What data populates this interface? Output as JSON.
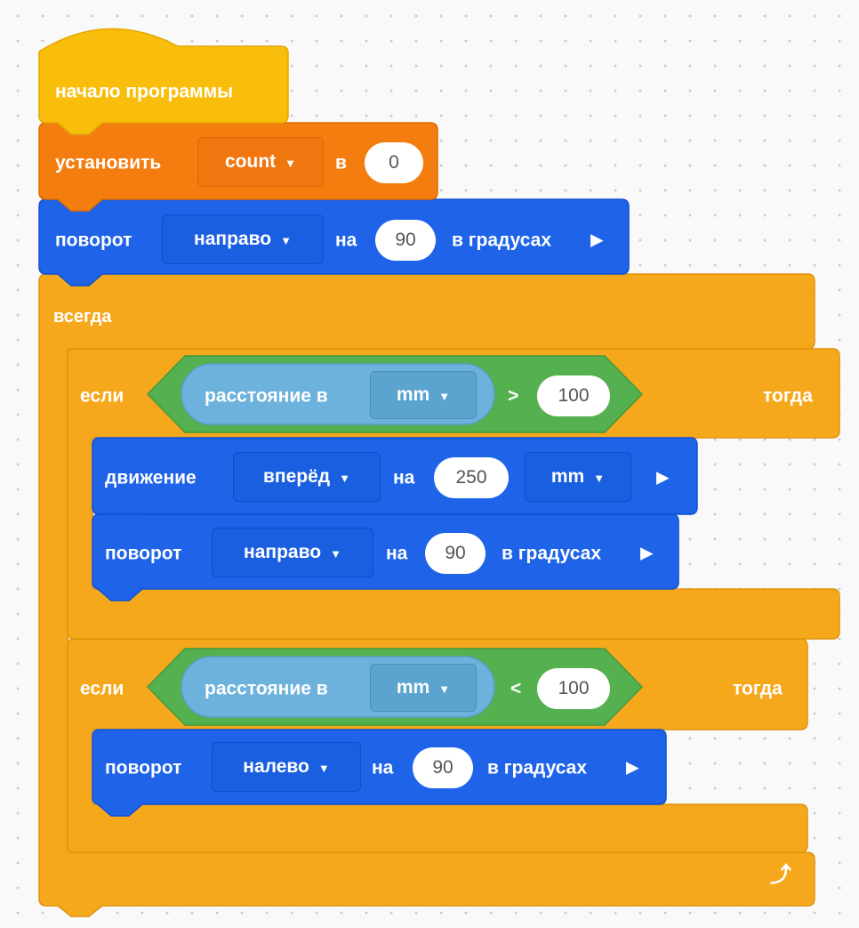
{
  "program": {
    "hat": {
      "label": "начало программы"
    },
    "set_var": {
      "label": "установить",
      "variable": "count",
      "to_label": "в",
      "value": "0"
    },
    "turn1": {
      "label": "поворот",
      "direction": "направо",
      "by_label": "на",
      "value": "90",
      "unit": "в градусах"
    },
    "forever": {
      "label": "всегда",
      "loop_icon": "loop-arrow-icon"
    },
    "if1": {
      "label": "если",
      "sensor": {
        "label": "расстояние в",
        "unit": "mm"
      },
      "operator": ">",
      "value": "100",
      "then_label": "тогда",
      "drive": {
        "label": "движение",
        "direction": "вперёд",
        "by_label": "на",
        "value": "250",
        "unit": "mm"
      },
      "turn": {
        "label": "поворот",
        "direction": "направо",
        "by_label": "на",
        "value": "90",
        "unit": "в градусах"
      }
    },
    "if2": {
      "label": "если",
      "sensor": {
        "label": "расстояние в",
        "unit": "mm"
      },
      "operator": "<",
      "value": "100",
      "then_label": "тогда",
      "turn": {
        "label": "поворот",
        "direction": "налево",
        "by_label": "на",
        "value": "90",
        "unit": "в градусах"
      }
    }
  },
  "icons": {
    "dropdown": "caret-down-icon",
    "run": "play-arrow-icon",
    "loop": "loop-arrow-icon"
  },
  "colors": {
    "events": "#f9be0c",
    "variables": "#f47d0f",
    "motion": "#1e63e8",
    "control": "#f6a81d",
    "operator": "#55b04f",
    "sensing": "#6cb2dc",
    "workspace": "#f9f9f9"
  }
}
